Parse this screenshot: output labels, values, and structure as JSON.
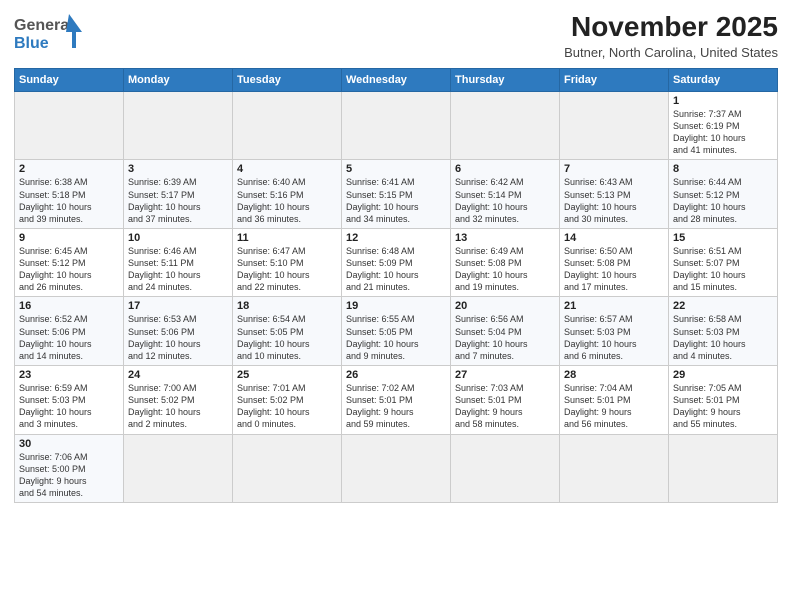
{
  "header": {
    "logo_line1": "General",
    "logo_line2": "Blue",
    "month": "November 2025",
    "location": "Butner, North Carolina, United States"
  },
  "days_of_week": [
    "Sunday",
    "Monday",
    "Tuesday",
    "Wednesday",
    "Thursday",
    "Friday",
    "Saturday"
  ],
  "weeks": [
    [
      {
        "day": null,
        "info": null
      },
      {
        "day": null,
        "info": null
      },
      {
        "day": null,
        "info": null
      },
      {
        "day": null,
        "info": null
      },
      {
        "day": null,
        "info": null
      },
      {
        "day": null,
        "info": null
      },
      {
        "day": "1",
        "info": "Sunrise: 7:37 AM\nSunset: 6:19 PM\nDaylight: 10 hours\nand 41 minutes."
      }
    ],
    [
      {
        "day": "2",
        "info": "Sunrise: 6:38 AM\nSunset: 5:18 PM\nDaylight: 10 hours\nand 39 minutes."
      },
      {
        "day": "3",
        "info": "Sunrise: 6:39 AM\nSunset: 5:17 PM\nDaylight: 10 hours\nand 37 minutes."
      },
      {
        "day": "4",
        "info": "Sunrise: 6:40 AM\nSunset: 5:16 PM\nDaylight: 10 hours\nand 36 minutes."
      },
      {
        "day": "5",
        "info": "Sunrise: 6:41 AM\nSunset: 5:15 PM\nDaylight: 10 hours\nand 34 minutes."
      },
      {
        "day": "6",
        "info": "Sunrise: 6:42 AM\nSunset: 5:14 PM\nDaylight: 10 hours\nand 32 minutes."
      },
      {
        "day": "7",
        "info": "Sunrise: 6:43 AM\nSunset: 5:13 PM\nDaylight: 10 hours\nand 30 minutes."
      },
      {
        "day": "8",
        "info": "Sunrise: 6:44 AM\nSunset: 5:12 PM\nDaylight: 10 hours\nand 28 minutes."
      }
    ],
    [
      {
        "day": "9",
        "info": "Sunrise: 6:45 AM\nSunset: 5:12 PM\nDaylight: 10 hours\nand 26 minutes."
      },
      {
        "day": "10",
        "info": "Sunrise: 6:46 AM\nSunset: 5:11 PM\nDaylight: 10 hours\nand 24 minutes."
      },
      {
        "day": "11",
        "info": "Sunrise: 6:47 AM\nSunset: 5:10 PM\nDaylight: 10 hours\nand 22 minutes."
      },
      {
        "day": "12",
        "info": "Sunrise: 6:48 AM\nSunset: 5:09 PM\nDaylight: 10 hours\nand 21 minutes."
      },
      {
        "day": "13",
        "info": "Sunrise: 6:49 AM\nSunset: 5:08 PM\nDaylight: 10 hours\nand 19 minutes."
      },
      {
        "day": "14",
        "info": "Sunrise: 6:50 AM\nSunset: 5:08 PM\nDaylight: 10 hours\nand 17 minutes."
      },
      {
        "day": "15",
        "info": "Sunrise: 6:51 AM\nSunset: 5:07 PM\nDaylight: 10 hours\nand 15 minutes."
      }
    ],
    [
      {
        "day": "16",
        "info": "Sunrise: 6:52 AM\nSunset: 5:06 PM\nDaylight: 10 hours\nand 14 minutes."
      },
      {
        "day": "17",
        "info": "Sunrise: 6:53 AM\nSunset: 5:06 PM\nDaylight: 10 hours\nand 12 minutes."
      },
      {
        "day": "18",
        "info": "Sunrise: 6:54 AM\nSunset: 5:05 PM\nDaylight: 10 hours\nand 10 minutes."
      },
      {
        "day": "19",
        "info": "Sunrise: 6:55 AM\nSunset: 5:05 PM\nDaylight: 10 hours\nand 9 minutes."
      },
      {
        "day": "20",
        "info": "Sunrise: 6:56 AM\nSunset: 5:04 PM\nDaylight: 10 hours\nand 7 minutes."
      },
      {
        "day": "21",
        "info": "Sunrise: 6:57 AM\nSunset: 5:03 PM\nDaylight: 10 hours\nand 6 minutes."
      },
      {
        "day": "22",
        "info": "Sunrise: 6:58 AM\nSunset: 5:03 PM\nDaylight: 10 hours\nand 4 minutes."
      }
    ],
    [
      {
        "day": "23",
        "info": "Sunrise: 6:59 AM\nSunset: 5:03 PM\nDaylight: 10 hours\nand 3 minutes."
      },
      {
        "day": "24",
        "info": "Sunrise: 7:00 AM\nSunset: 5:02 PM\nDaylight: 10 hours\nand 2 minutes."
      },
      {
        "day": "25",
        "info": "Sunrise: 7:01 AM\nSunset: 5:02 PM\nDaylight: 10 hours\nand 0 minutes."
      },
      {
        "day": "26",
        "info": "Sunrise: 7:02 AM\nSunset: 5:01 PM\nDaylight: 9 hours\nand 59 minutes."
      },
      {
        "day": "27",
        "info": "Sunrise: 7:03 AM\nSunset: 5:01 PM\nDaylight: 9 hours\nand 58 minutes."
      },
      {
        "day": "28",
        "info": "Sunrise: 7:04 AM\nSunset: 5:01 PM\nDaylight: 9 hours\nand 56 minutes."
      },
      {
        "day": "29",
        "info": "Sunrise: 7:05 AM\nSunset: 5:01 PM\nDaylight: 9 hours\nand 55 minutes."
      }
    ],
    [
      {
        "day": "30",
        "info": "Sunrise: 7:06 AM\nSunset: 5:00 PM\nDaylight: 9 hours\nand 54 minutes."
      },
      {
        "day": null,
        "info": null
      },
      {
        "day": null,
        "info": null
      },
      {
        "day": null,
        "info": null
      },
      {
        "day": null,
        "info": null
      },
      {
        "day": null,
        "info": null
      },
      {
        "day": null,
        "info": null
      }
    ]
  ]
}
